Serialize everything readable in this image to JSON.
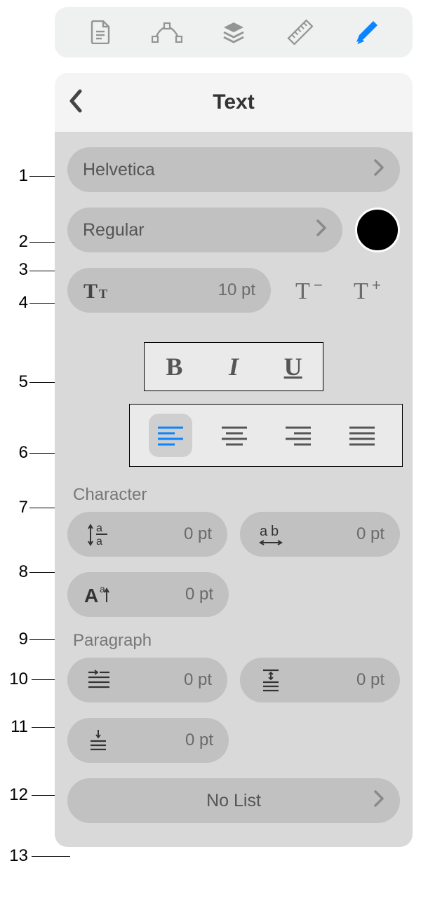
{
  "header": {
    "title": "Text"
  },
  "font": {
    "family": "Helvetica",
    "weight": "Regular",
    "size_label": "10 pt",
    "decrease_label": "T–",
    "increase_label": "T+"
  },
  "character": {
    "section_label": "Character",
    "line_spacing": "0 pt",
    "tracking": "0 pt",
    "baseline": "0 pt"
  },
  "paragraph": {
    "section_label": "Paragraph",
    "first_indent": "0 pt",
    "before": "0 pt",
    "after": "0 pt"
  },
  "list": {
    "label": "No List"
  },
  "callouts": {
    "c1": "1",
    "c2": "2",
    "c3": "3",
    "c4": "4",
    "c5": "5",
    "c6": "6",
    "c7": "7",
    "c8": "8",
    "c9": "9",
    "c10": "10",
    "c11": "11",
    "c12": "12",
    "c13": "13"
  },
  "swatch_color": "#000000"
}
